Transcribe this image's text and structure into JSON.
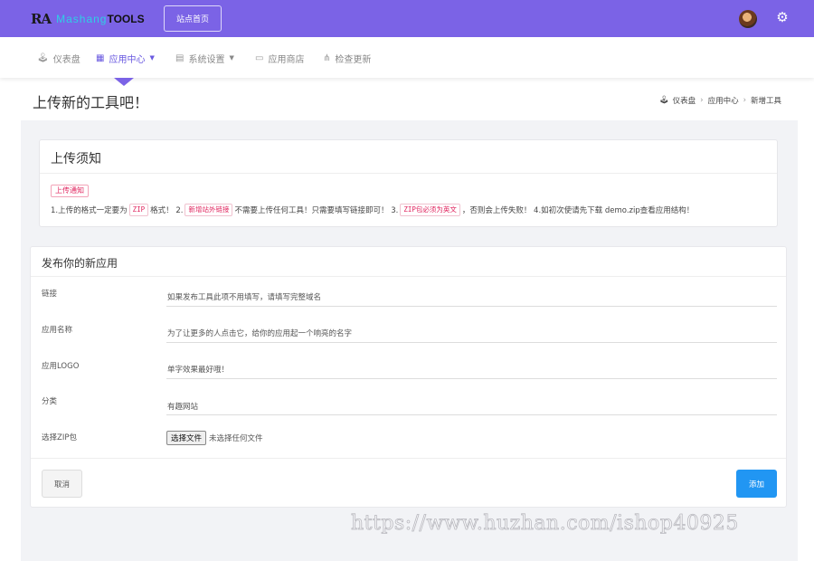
{
  "colors": {
    "topbar": "#7b63e6",
    "accent": "#6a5ae0",
    "primary_button": "#2196f3",
    "tag_red": "#e0245e",
    "content_bg": "#f2f3f6"
  },
  "header": {
    "logo_mark": "RA",
    "logo_word": "Mashang",
    "logo_tools": "TOOLS",
    "site_home_label": "站点首页",
    "avatar_icon": "user-avatar",
    "settings_icon": "gear-icon"
  },
  "nav": [
    {
      "label": "仪表盘",
      "icon": "dashboard-icon",
      "glyph": "🕹"
    },
    {
      "label": "应用中心",
      "icon": "grid-icon",
      "glyph": "▦",
      "active": true,
      "dropdown": true
    },
    {
      "label": "系统设置",
      "icon": "table-icon",
      "glyph": "▤",
      "dropdown": true
    },
    {
      "label": "应用商店",
      "icon": "laptop-icon",
      "glyph": "▭"
    },
    {
      "label": "检查更新",
      "icon": "sitemap-icon",
      "glyph": "⋔"
    }
  ],
  "page": {
    "title": "上传新的工具吧！"
  },
  "breadcrumb": {
    "home": "仪表盘",
    "level2": "应用中心",
    "current": "新增工具"
  },
  "notice": {
    "title": "上传须知",
    "badge": "上传通知",
    "t1": "1.上传的格式一定要为",
    "c1": "ZIP",
    "t2": "格式！ 2.",
    "c2": "新增站外链接",
    "t3": "不需要上传任何工具！只需要填写链接即可！ 3.",
    "c3": "ZIP包必须为英文",
    "t4": "，否则会上传失败！ 4.如初次使请先下载 demo.zip查看应用结构！"
  },
  "form": {
    "title": "发布你的新应用",
    "link_label": "链接",
    "link_placeholder": "如果发布工具此项不用填写，请填写完整域名",
    "name_label": "应用名称",
    "name_placeholder": "为了让更多的人点击它，给你的应用起一个响亮的名字",
    "logo_label": "应用LOGO",
    "logo_placeholder": "单字效果最好哦！",
    "category_label": "分类",
    "category_value": "有趣网站",
    "zip_label": "选择ZIP包",
    "file_button": "选择文件",
    "file_status": "未选择任何文件",
    "cancel_label": "取消",
    "add_label": "添加"
  },
  "watermark": "https://www.huzhan.com/ishop40925"
}
